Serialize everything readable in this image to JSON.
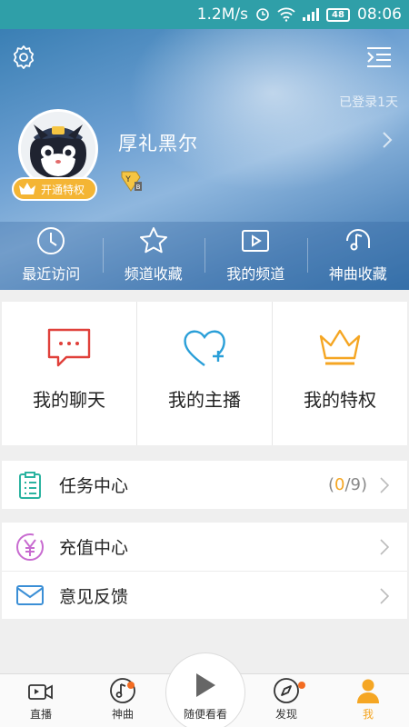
{
  "status_bar": {
    "speed": "1.2M/s",
    "battery": "48",
    "time": "08:06"
  },
  "header": {
    "login_days": "已登录1天",
    "username": "厚礼黑尔",
    "vip_label": "开通特权",
    "level_badge": "Y",
    "quick_links": [
      {
        "label": "最近访问",
        "icon": "clock-icon"
      },
      {
        "label": "频道收藏",
        "icon": "star-icon"
      },
      {
        "label": "我的频道",
        "icon": "play-screen-icon"
      },
      {
        "label": "神曲收藏",
        "icon": "music-note-icon"
      }
    ]
  },
  "shortcuts": [
    {
      "label": "我的聊天",
      "icon": "chat-bubble-icon",
      "color": "#e0403a"
    },
    {
      "label": "我的主播",
      "icon": "heart-plus-icon",
      "color": "#2a9fd8"
    },
    {
      "label": "我的特权",
      "icon": "crown-icon",
      "color": "#f5a623"
    }
  ],
  "list": {
    "task": {
      "label": "任务中心",
      "progress_done": "0",
      "progress_total": "9"
    },
    "recharge": {
      "label": "充值中心"
    },
    "feedback": {
      "label": "意见反馈"
    }
  },
  "bottom_nav": {
    "live": "直播",
    "songs": "神曲",
    "random": "随便看看",
    "discover": "发现",
    "me": "我"
  },
  "colors": {
    "accent": "#f5a623",
    "statusbar": "#2f9fa8",
    "badge_dot": "#f36c21"
  }
}
